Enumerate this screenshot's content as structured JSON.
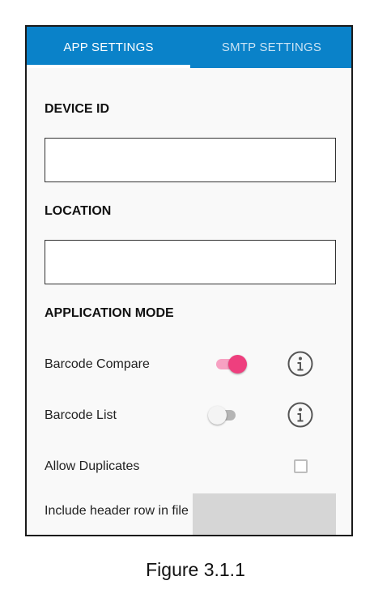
{
  "tabs": {
    "app_settings": "APP SETTINGS",
    "smtp_settings": "SMTP SETTINGS"
  },
  "fields": {
    "device_id": {
      "label": "DEVICE ID",
      "value": ""
    },
    "location": {
      "label": "LOCATION",
      "value": ""
    }
  },
  "application_mode": {
    "heading": "APPLICATION MODE",
    "barcode_compare": {
      "label": "Barcode Compare",
      "enabled": true,
      "info_icon": "info-icon"
    },
    "barcode_list": {
      "label": "Barcode List",
      "enabled": false,
      "info_icon": "info-icon"
    },
    "allow_duplicates": {
      "label": "Allow Duplicates",
      "checked": false
    },
    "include_header_row": {
      "label": "Include header row in file"
    }
  },
  "colors": {
    "tab_bar": "#0a82c9",
    "toggle_on": "#ee3f7e",
    "toggle_on_track": "#f7a1c2",
    "toggle_off": "#b5b5b5"
  },
  "caption": "Figure 3.1.1"
}
